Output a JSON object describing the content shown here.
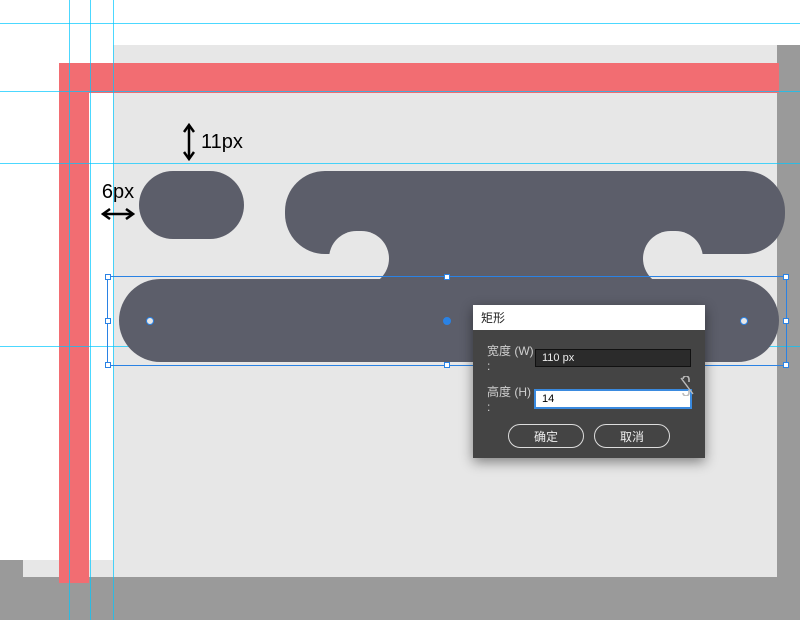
{
  "colors": {
    "canvas_gray": "#9a9a9a",
    "artboard_bg": "#e7e7e7",
    "red": "#f26d72",
    "shape_slate": "#5c5e6a",
    "guide_cyan": "#00c8ff",
    "selection_blue": "#2a82e4"
  },
  "measurements": {
    "vertical_label": "11px",
    "horizontal_label": "6px"
  },
  "dialog": {
    "title": "矩形",
    "width_label": "宽度 (W) :",
    "height_label": "高度 (H) :",
    "width_value": "110 px",
    "height_value": "14",
    "ok": "确定",
    "cancel": "取消",
    "link_constrain": false
  },
  "selection": {
    "handles": 8,
    "live_corner_widgets": 4
  }
}
